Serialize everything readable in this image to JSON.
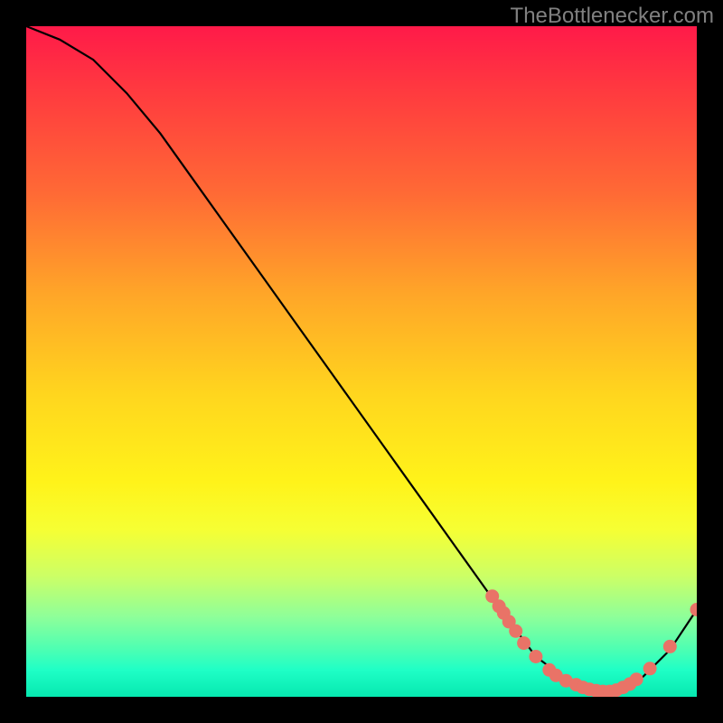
{
  "watermark": "TheBottlenecker.com",
  "chart_data": {
    "type": "line",
    "title": "",
    "xlabel": "",
    "ylabel": "",
    "xlim": [
      0,
      100
    ],
    "ylim": [
      0,
      100
    ],
    "x": [
      0,
      5,
      10,
      15,
      20,
      25,
      30,
      35,
      40,
      45,
      50,
      55,
      60,
      65,
      70,
      73,
      76,
      80,
      84,
      88,
      92,
      96,
      100
    ],
    "values": [
      100,
      98,
      95,
      90,
      84,
      77,
      70,
      63,
      56,
      49,
      42,
      35,
      28,
      21,
      14,
      10,
      6,
      3,
      1,
      1,
      3,
      7,
      13
    ],
    "markers": [
      {
        "x": 69.5,
        "y": 15.0
      },
      {
        "x": 70.5,
        "y": 13.5
      },
      {
        "x": 71.2,
        "y": 12.5
      },
      {
        "x": 72.0,
        "y": 11.2
      },
      {
        "x": 73.0,
        "y": 9.8
      },
      {
        "x": 74.2,
        "y": 8.0
      },
      {
        "x": 76.0,
        "y": 6.0
      },
      {
        "x": 78.0,
        "y": 4.0
      },
      {
        "x": 79.0,
        "y": 3.2
      },
      {
        "x": 80.5,
        "y": 2.4
      },
      {
        "x": 82.0,
        "y": 1.8
      },
      {
        "x": 83.0,
        "y": 1.4
      },
      {
        "x": 84.0,
        "y": 1.1
      },
      {
        "x": 85.0,
        "y": 0.9
      },
      {
        "x": 86.0,
        "y": 0.8
      },
      {
        "x": 87.0,
        "y": 0.8
      },
      {
        "x": 88.0,
        "y": 1.0
      },
      {
        "x": 89.0,
        "y": 1.4
      },
      {
        "x": 90.0,
        "y": 1.9
      },
      {
        "x": 91.0,
        "y": 2.6
      },
      {
        "x": 93.0,
        "y": 4.2
      },
      {
        "x": 96.0,
        "y": 7.5
      },
      {
        "x": 100.0,
        "y": 13.0
      }
    ],
    "marker_color": "#e97367",
    "line_color": "#000000"
  }
}
